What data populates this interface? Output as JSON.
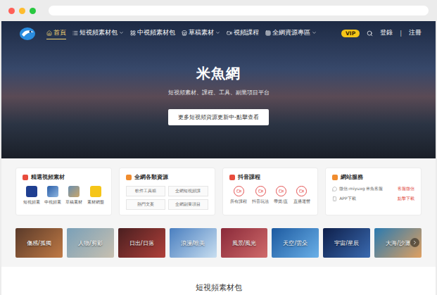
{
  "nav": {
    "items": [
      {
        "label": "首頁",
        "selected": true,
        "dropdown": false
      },
      {
        "label": "短視頻素材包",
        "selected": false,
        "dropdown": true
      },
      {
        "label": "中視頻素材包",
        "selected": false,
        "dropdown": false
      },
      {
        "label": "草稿素材",
        "selected": false,
        "dropdown": true
      },
      {
        "label": "視頻課程",
        "selected": false,
        "dropdown": false
      },
      {
        "label": "全網資源專區",
        "selected": false,
        "dropdown": true
      }
    ],
    "vip": "VIP",
    "login": "登錄",
    "separator": "|",
    "register": "注冊"
  },
  "hero": {
    "title": "米魚網",
    "subtitle": "短視頻素材、課程、工具、副業項目平台",
    "button": "更多短視頻資源更新中-點擊查看"
  },
  "cards": [
    {
      "title": "精選視頻素材",
      "kind": "icons",
      "items": [
        {
          "label": "短視頻素"
        },
        {
          "label": "中視頻素"
        },
        {
          "label": "草稿素材"
        },
        {
          "label": "素材網盤"
        }
      ]
    },
    {
      "title": "全網各類資源",
      "kind": "tags",
      "items": [
        {
          "label": "軟件工具箱"
        },
        {
          "label": "全網短視頻課"
        },
        {
          "label": "熱門文案"
        },
        {
          "label": "全網副業項目"
        }
      ]
    },
    {
      "title": "抖音課程",
      "kind": "circles",
      "items": [
        {
          "label": "所有課程"
        },
        {
          "label": "抖音玩法"
        },
        {
          "label": "帶貨/直"
        },
        {
          "label": "直播運營"
        }
      ]
    },
    {
      "title": "網站服務",
      "kind": "services",
      "items": [
        {
          "label": "微信:miyuxg 米魚客服",
          "action": "客服微信"
        },
        {
          "label": "APP下載",
          "action": "點擊下載"
        }
      ]
    }
  ],
  "categories": [
    "傷感/孤獨",
    "人物/剪影",
    "日出/日落",
    "浪漫/唯美",
    "風景/風光",
    "天空/雲朵",
    "宇宙/星辰",
    "大海/沙灘"
  ],
  "section": {
    "title": "短視頻素材包"
  }
}
